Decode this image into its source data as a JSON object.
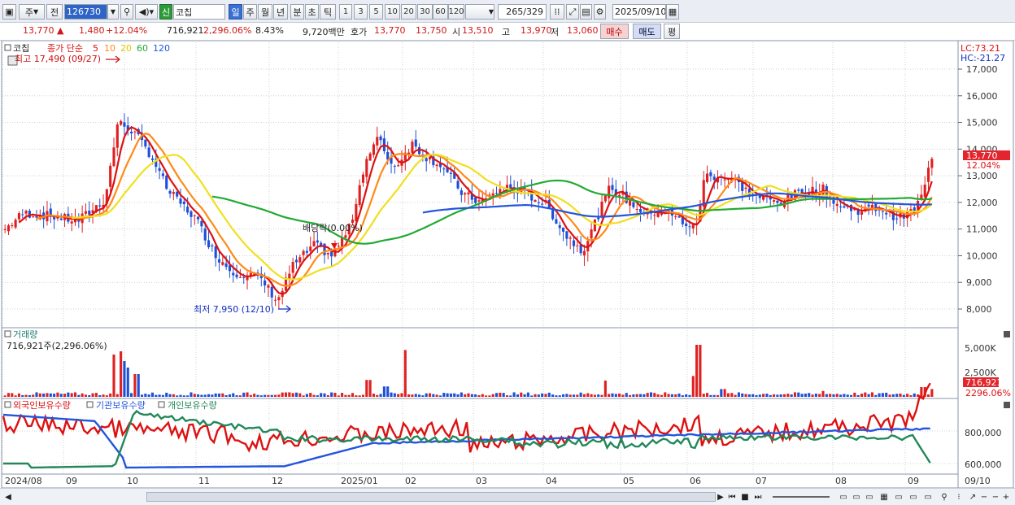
{
  "toolbar": {
    "period_select": "주",
    "prev_select": "전",
    "stock_code": "126730",
    "stock_badge": "신",
    "stock_name": "코칩",
    "tabs": [
      "일",
      "주",
      "월",
      "년",
      "분",
      "초",
      "틱"
    ],
    "active_tab": "일",
    "intervals": [
      "1",
      "3",
      "5",
      "10",
      "20",
      "30",
      "60",
      "120"
    ],
    "count_current": "265",
    "count_total": "/329",
    "date": "2025/09/10"
  },
  "quote": {
    "price": "13,770",
    "change_arrow": "▲",
    "change": "1,480",
    "change_pct": "+12.04%",
    "volume": "716,921",
    "volume_pct": "2,296.06%",
    "turnover_pct": "8.43%",
    "amount": "9,720백만",
    "bid_label": "호가",
    "bid1": "13,770",
    "bid2": "13,750",
    "open_label": "시",
    "open": "13,510",
    "high_label": "고",
    "high": "13,970",
    "low_label": "저",
    "low": "13,060",
    "buy_button": "매수",
    "sell_button": "매도",
    "eval_button": "평"
  },
  "price_panel": {
    "legend_name": "코칩",
    "legend_ma": "종가 단순",
    "ma_periods": [
      "5",
      "10",
      "20",
      "60",
      "120"
    ],
    "ma_colors": [
      "#dd1111",
      "#ff8a1a",
      "#f0e020",
      "#22aa33",
      "#2255dd"
    ],
    "high_annotation": "최고 17,490 (09/27)",
    "low_annotation": "최저 7,950 (12/10)",
    "dividend_annotation": "배당락(0.00%)",
    "lc": "LC:73.21",
    "hc": "HC:-21.27",
    "y_ticks": [
      "17,000",
      "16,000",
      "15,000",
      "14,000",
      "13,000",
      "12,000",
      "11,000",
      "10,000",
      "9,000",
      "8,000"
    ],
    "current_price_label": "13,770",
    "current_pct_label": "12.04%"
  },
  "volume_panel": {
    "title": "거래량",
    "value": "716,921주(2,296.06%)",
    "y_ticks": [
      "5,000K",
      "2,500K"
    ],
    "current_label": "716,921",
    "current_pct": "2296.06%"
  },
  "holdings_panel": {
    "legend": [
      "외국인보유수량",
      "기관보유수량",
      "개인보유수량"
    ],
    "colors": [
      "#dd1111",
      "#2255dd",
      "#22885a"
    ],
    "y_ticks": [
      "800,000",
      "600,000"
    ]
  },
  "x_axis": {
    "labels": [
      "2024/08",
      "09",
      "10",
      "11",
      "12",
      "2025/01",
      "02",
      "03",
      "04",
      "05",
      "06",
      "07",
      "08",
      "09"
    ],
    "end_date": "09/10"
  }
}
